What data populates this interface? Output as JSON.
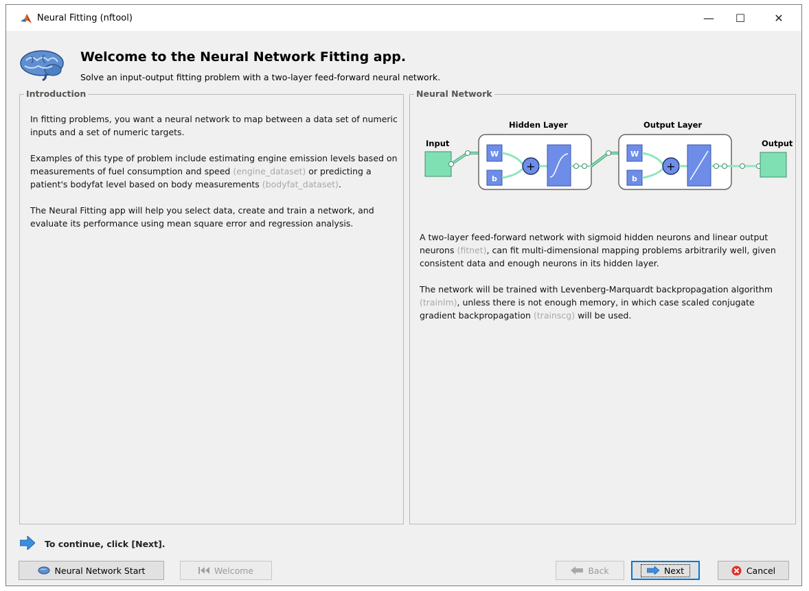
{
  "window": {
    "title": "Neural Fitting (nftool)",
    "app_icon": "matlab-icon",
    "controls": {
      "minimize": "—",
      "maximize": "☐",
      "close": "✕"
    }
  },
  "header": {
    "title": "Welcome to the Neural Network Fitting app.",
    "subtitle": "Solve an input-output fitting problem with a two-layer feed-forward neural network.",
    "icon": "brain-icon"
  },
  "introduction": {
    "title": "Introduction",
    "p1": "In fitting problems, you want a neural network to map between a data set of numeric inputs and a set of numeric targets.",
    "p2_a": "Examples of this type of problem include estimating engine emission levels based on measurements of fuel consumption and speed",
    "p2_link1": "(engine_dataset)",
    "p2_b": "or predicting a patient's bodyfat level based on body measurements",
    "p2_link2": "(bodyfat_dataset)",
    "p2_c": ".",
    "p3": "The Neural Fitting app will help you select data, create and train a network, and evaluate its performance using mean square error and regression analysis."
  },
  "neural_network": {
    "title": "Neural Network",
    "diagram": {
      "input_label": "Input",
      "hidden_label": "Hidden Layer",
      "output_layer_label": "Output Layer",
      "output_label": "Output",
      "w_label": "W",
      "b_label": "b",
      "plus_symbol": "+"
    },
    "p1_a": "A two-layer feed-forward network with sigmoid hidden neurons and linear output neurons",
    "p1_link": "(fitnet)",
    "p1_b": ", can fit multi-dimensional mapping problems arbitrarily well, given consistent data and enough neurons in its hidden layer.",
    "p2_a": "The network will be trained with Levenberg-Marquardt backpropagation algorithm",
    "p2_link1": "(trainlm)",
    "p2_b": ", unless there is not enough memory, in which case scaled conjugate gradient backpropagation",
    "p2_link2": "(trainscg)",
    "p2_c": "will be used."
  },
  "footer": {
    "continue_text": "To continue, click [Next].",
    "buttons": {
      "nn_start": "Neural Network Start",
      "welcome": "Welcome",
      "back": "Back",
      "next": "Next",
      "cancel": "Cancel"
    }
  },
  "colors": {
    "node_green": "#7fe0b4",
    "block_blue": "#6e8de8",
    "link_gray": "#a8a8a8",
    "focus_blue": "#0078d7",
    "cancel_red": "#d9342b"
  }
}
